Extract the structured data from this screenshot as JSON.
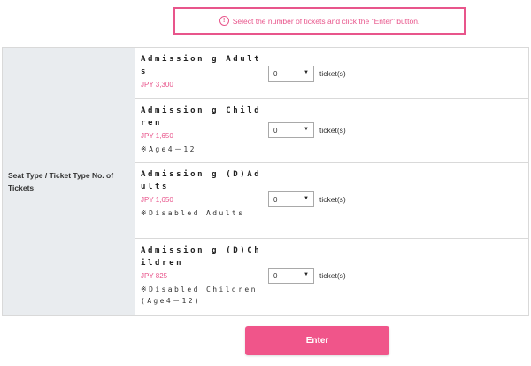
{
  "notice": {
    "icon": "info-circle-icon",
    "text": "Select the number of tickets and click the \"Enter\" button."
  },
  "table": {
    "header": "Seat Type / Ticket Type No. of Tickets",
    "unit": "ticket(s)",
    "rows": [
      {
        "name": "Admission g Adults",
        "price": "JPY 3,300",
        "note": "",
        "quantity": "0"
      },
      {
        "name": "Admission g Children",
        "price": "JPY 1,650",
        "note": "※Age4－12",
        "quantity": "0"
      },
      {
        "name": "Admission g (D)Adults",
        "price": "JPY 1,650",
        "note": "※Disabled Adults",
        "quantity": "0"
      },
      {
        "name": "Admission g (D)Children",
        "price": "JPY 825",
        "note": "※Disabled Children(Age4－12)",
        "quantity": "0"
      }
    ]
  },
  "enter_button": {
    "label": "Enter"
  },
  "colors": {
    "accent": "#e8558b",
    "button": "#f0558a",
    "header_bg": "#e9ecef"
  }
}
